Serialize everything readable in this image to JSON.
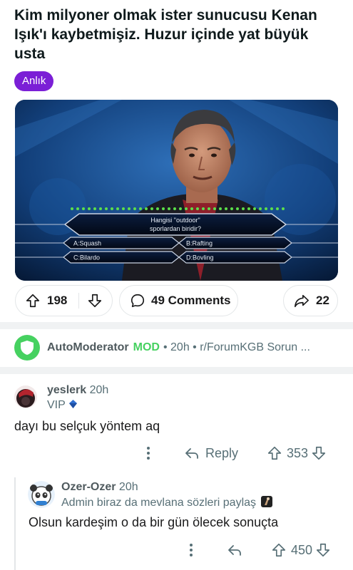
{
  "post": {
    "title": "Kim milyoner olmak ister sunucusu Kenan Işık'ı kaybetmişiz. Huzur içinde yat büyük usta",
    "flair": "Anlık",
    "image": {
      "question": "Hangisi \"outdoor\" sporlardan biridir?",
      "answers": [
        "A:Squash",
        "B:Rafting",
        "C:Bilardo",
        "D:Bovling"
      ]
    },
    "upvotes": "198",
    "comments_label": "49 Comments",
    "shares": "22"
  },
  "automod": {
    "name": "AutoModerator",
    "badge": "MOD",
    "meta": "• 20h • r/ForumKGB Sorun ..."
  },
  "comments": [
    {
      "author": "yeslerk",
      "time": "20h",
      "flair": "VIP",
      "body": "dayı bu selçuk yöntem aq",
      "reply_label": "Reply",
      "score": "353"
    },
    {
      "author": "Ozer-Ozer",
      "time": "20h",
      "flair": "Admin biraz da mevlana sözleri paylaş",
      "body": "Olsun kardeşim o da bir gün ölecek sonuçta",
      "score": "450"
    }
  ],
  "colors": {
    "flair_bg": "#7b1fd6",
    "mod_green": "#46d160",
    "text_muted": "#576f76"
  }
}
